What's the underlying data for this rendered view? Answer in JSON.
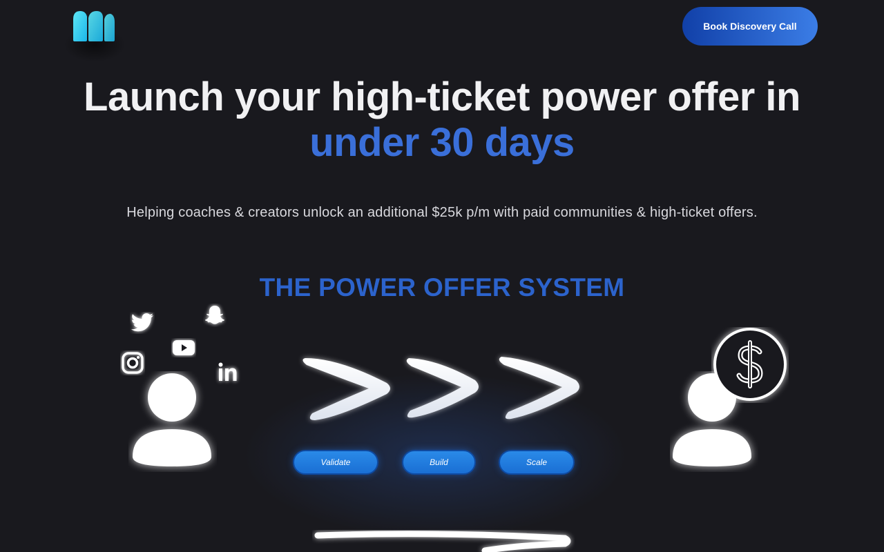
{
  "header": {
    "cta_label": "Book Discovery Call"
  },
  "hero": {
    "headline_line1": "Launch your high-ticket power offer in",
    "headline_accent": "under 30 days",
    "subheadline": "Helping coaches & creators unlock an additional $25k p/m with paid communities & high-ticket offers."
  },
  "system": {
    "title": "THE POWER OFFER SYSTEM",
    "steps": [
      {
        "label": "Validate"
      },
      {
        "label": "Build"
      },
      {
        "label": "Scale"
      }
    ],
    "social_icons": [
      "twitter-icon",
      "snapchat-icon",
      "youtube-icon",
      "instagram-icon",
      "linkedin-icon"
    ],
    "result_icon": "dollar-icon"
  },
  "colors": {
    "background": "#19191e",
    "accent_blue": "#3a6fd9",
    "title_blue": "#2c63cc",
    "cta_gradient_start": "#1140a8",
    "cta_gradient_end": "#3b7de6",
    "logo_cyan": "#22d3ee"
  }
}
